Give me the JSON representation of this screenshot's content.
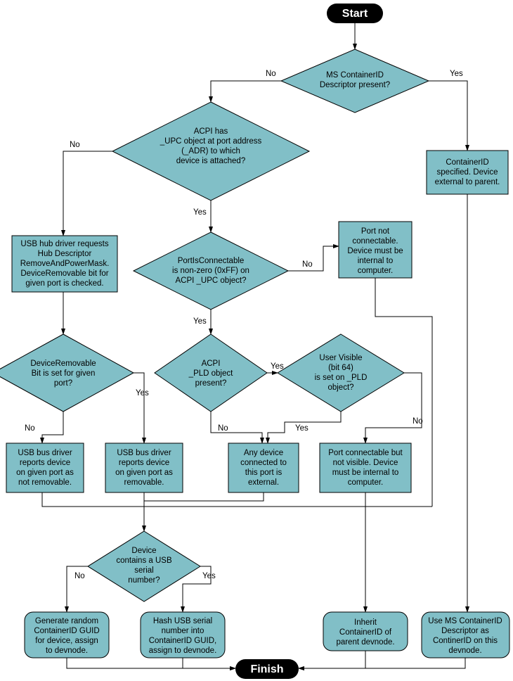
{
  "chart_data": {
    "type": "flowchart",
    "title": "USB ContainerID assignment logic",
    "nodes": [
      {
        "id": "start",
        "type": "terminator",
        "text": "Start"
      },
      {
        "id": "d_ms_present",
        "type": "decision",
        "text": "MS ContainerID Descriptor present?"
      },
      {
        "id": "d_upc_port",
        "type": "decision",
        "text": "ACPI has _UPC object at port address (_ADR) to which device is attached?"
      },
      {
        "id": "p_cid_spec",
        "type": "process",
        "text": "ContainerID specified. Device external to parent."
      },
      {
        "id": "p_hubreq",
        "type": "process",
        "text": "USB hub driver requests Hub Descriptor RemoveAndPowerMask. DeviceRemovable bit for given port is checked."
      },
      {
        "id": "d_portconn",
        "type": "decision",
        "text": "PortIsConnectable is non-zero (0xFF) on ACPI _UPC object?"
      },
      {
        "id": "p_notconn",
        "type": "process",
        "text": "Port not connectable. Device must be internal to computer."
      },
      {
        "id": "d_devrem",
        "type": "decision",
        "text": "DeviceRemovable Bit is set for given port?"
      },
      {
        "id": "d_pld",
        "type": "decision",
        "text": "ACPI _PLD object present?"
      },
      {
        "id": "d_uvis",
        "type": "decision",
        "text": "User Visible (bit 64) is set on _PLD object?"
      },
      {
        "id": "p_notrem",
        "type": "process",
        "text": "USB bus driver reports device on given port as not removable."
      },
      {
        "id": "p_rem",
        "type": "process",
        "text": "USB bus driver reports device on given port as removable."
      },
      {
        "id": "p_anyext",
        "type": "process",
        "text": "Any device connected to this port is external."
      },
      {
        "id": "p_connnotvis",
        "type": "process",
        "text": "Port connectable but not visible. Device must be internal to computer."
      },
      {
        "id": "d_serial",
        "type": "decision",
        "text": "Device contains a USB serial number?"
      },
      {
        "id": "r_random",
        "type": "rounded",
        "text": "Generate random ContainerID GUID for device, assign to devnode."
      },
      {
        "id": "r_hash",
        "type": "rounded",
        "text": "Hash USB serial number into ContainerID GUID, assign to devnode."
      },
      {
        "id": "r_inherit",
        "type": "rounded",
        "text": "Inherit ContainerID of parent devnode."
      },
      {
        "id": "r_usems",
        "type": "rounded",
        "text": "Use MS ContainerID Descriptor as ContinerID on this devnode."
      },
      {
        "id": "finish",
        "type": "terminator",
        "text": "Finish"
      }
    ],
    "edges": [
      {
        "from": "start",
        "to": "d_ms_present"
      },
      {
        "from": "d_ms_present",
        "to": "p_cid_spec",
        "label": "Yes"
      },
      {
        "from": "d_ms_present",
        "to": "d_upc_port",
        "label": "No"
      },
      {
        "from": "d_upc_port",
        "to": "p_hubreq",
        "label": "No"
      },
      {
        "from": "d_upc_port",
        "to": "d_portconn",
        "label": "Yes"
      },
      {
        "from": "p_hubreq",
        "to": "d_devrem"
      },
      {
        "from": "d_portconn",
        "to": "p_notconn",
        "label": "No"
      },
      {
        "from": "d_portconn",
        "to": "d_pld",
        "label": "Yes"
      },
      {
        "from": "d_devrem",
        "to": "p_notrem",
        "label": "No"
      },
      {
        "from": "d_devrem",
        "to": "p_rem",
        "label": "Yes"
      },
      {
        "from": "d_pld",
        "to": "d_uvis",
        "label": "Yes"
      },
      {
        "from": "d_pld",
        "to": "p_anyext",
        "label": "No"
      },
      {
        "from": "d_uvis",
        "to": "p_anyext",
        "label": "Yes"
      },
      {
        "from": "d_uvis",
        "to": "p_connnotvis",
        "label": "No"
      },
      {
        "from": "p_notrem",
        "to": "r_inherit"
      },
      {
        "from": "p_connnotvis",
        "to": "r_inherit"
      },
      {
        "from": "p_notconn",
        "to": "r_inherit"
      },
      {
        "from": "p_rem",
        "to": "d_serial"
      },
      {
        "from": "p_anyext",
        "to": "d_serial"
      },
      {
        "from": "d_serial",
        "to": "r_random",
        "label": "No"
      },
      {
        "from": "d_serial",
        "to": "r_hash",
        "label": "Yes"
      },
      {
        "from": "p_cid_spec",
        "to": "r_usems"
      },
      {
        "from": "r_random",
        "to": "finish"
      },
      {
        "from": "r_hash",
        "to": "finish"
      },
      {
        "from": "r_inherit",
        "to": "finish"
      },
      {
        "from": "r_usems",
        "to": "finish"
      }
    ]
  },
  "start": "Start",
  "finish": "Finish",
  "d_ms_present_1": "MS ContainerID",
  "d_ms_present_2": "Descriptor present?",
  "d_upc_1": "ACPI has",
  "d_upc_2": "_UPC object at port address",
  "d_upc_3": "(_ADR) to which",
  "d_upc_4": "device is attached?",
  "p_cid_1": "ContainerID",
  "p_cid_2": "specified. Device",
  "p_cid_3": "external to parent.",
  "p_hub_1": "USB hub driver requests",
  "p_hub_2": "Hub Descriptor",
  "p_hub_3": "RemoveAndPowerMask.",
  "p_hub_4": "DeviceRemovable bit for",
  "p_hub_5": "given port is checked.",
  "d_pc_1": "PortIsConnectable",
  "d_pc_2": "is non-zero (0xFF) on",
  "d_pc_3": "ACPI _UPC object?",
  "p_nc_1": "Port not",
  "p_nc_2": "connectable.",
  "p_nc_3": "Device must be",
  "p_nc_4": "internal to",
  "p_nc_5": "computer.",
  "d_dr_1": "DeviceRemovable",
  "d_dr_2": "Bit is set for given",
  "d_dr_3": "port?",
  "d_pld_1": "ACPI",
  "d_pld_2": "_PLD object",
  "d_pld_3": "present?",
  "d_uv_1": "User Visible",
  "d_uv_2": "(bit 64)",
  "d_uv_3": "is set on _PLD",
  "d_uv_4": "object?",
  "p_nr_1": "USB bus driver",
  "p_nr_2": "reports device",
  "p_nr_3": "on given port as",
  "p_nr_4": "not removable.",
  "p_r_1": "USB bus driver",
  "p_r_2": "reports device",
  "p_r_3": "on given port as",
  "p_r_4": "removable.",
  "p_ae_1": "Any device",
  "p_ae_2": "connected to",
  "p_ae_3": "this port is",
  "p_ae_4": "external.",
  "p_cv_1": "Port connectable but",
  "p_cv_2": "not visible. Device",
  "p_cv_3": "must be internal to",
  "p_cv_4": "computer.",
  "d_sn_1": "Device",
  "d_sn_2": "contains a USB",
  "d_sn_3": "serial",
  "d_sn_4": "number?",
  "r_rand_1": "Generate random",
  "r_rand_2": "ContainerID GUID",
  "r_rand_3": "for device, assign",
  "r_rand_4": "to devnode.",
  "r_hash_1": "Hash USB serial",
  "r_hash_2": "number into",
  "r_hash_3": "ContainerID GUID,",
  "r_hash_4": "assign to devnode.",
  "r_inh_1": "Inherit",
  "r_inh_2": "ContainerID of",
  "r_inh_3": "parent devnode.",
  "r_ms_1": "Use MS ContainerID",
  "r_ms_2": "Descriptor as",
  "r_ms_3": "ContinerID on this",
  "r_ms_4": "devnode.",
  "yes": "Yes",
  "no": "No"
}
